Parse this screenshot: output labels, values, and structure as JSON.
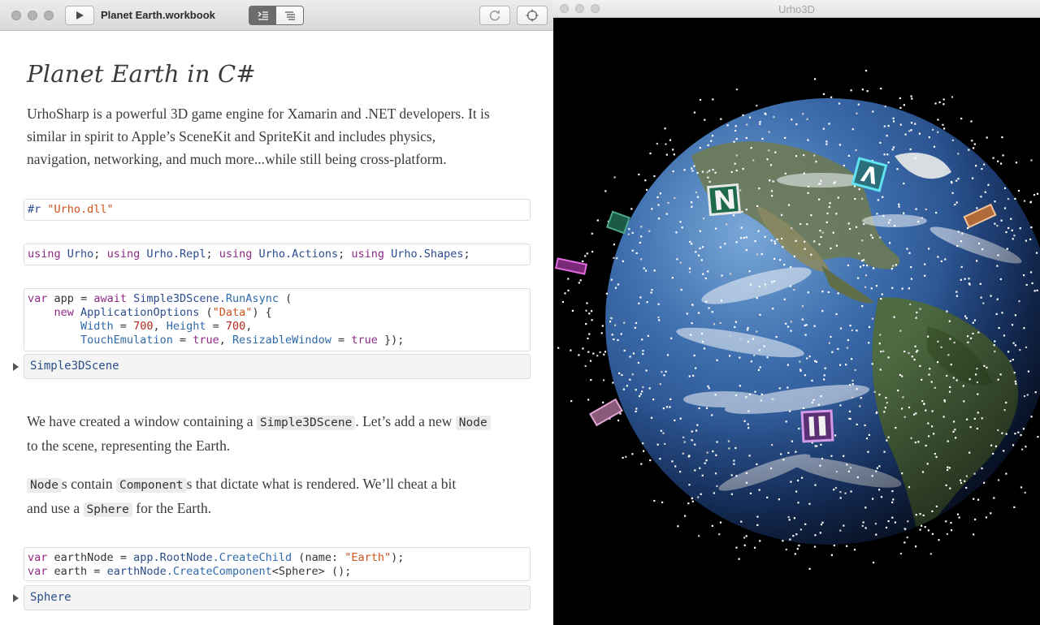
{
  "workbook": {
    "title": "Planet Earth.workbook",
    "heading": "Planet Earth in C#",
    "intro": [
      "UrhoSharp is a powerful 3D game engine for Xamarin and .NET developers. It is",
      "similar in spirit to Apple’s SceneKit and SpriteKit and includes physics,",
      "navigation, networking, and much more...while still being cross-platform."
    ],
    "cells": {
      "ref": {
        "directive": "#r",
        "file": "\"Urho.dll\""
      },
      "usings": {
        "kw": "using",
        "ns": [
          "Urho",
          "Urho.Repl",
          "Urho.Actions",
          "Urho.Shapes"
        ]
      },
      "scene": {
        "line1": {
          "var": "var",
          "name": "app",
          "eq": "=",
          "await": "await",
          "cls": "Simple3DScene",
          "method": ".RunAsync",
          "open": "("
        },
        "line2": {
          "new": "new",
          "cls": "ApplicationOptions",
          "arg": "\"Data\"",
          "rest": ") {"
        },
        "line3": {
          "w": "Width",
          "wv": "700",
          "h": "Height",
          "hv": "700"
        },
        "line4": {
          "te": "TouchEmulation",
          "tv": "true",
          "rw": "ResizableWindow",
          "rv": "true",
          "end": "});"
        },
        "result": "Simple3DScene"
      },
      "earth": {
        "line1": {
          "var": "var",
          "name": "earthNode",
          "root": "app.RootNode",
          "method": ".CreateChild",
          "param": "name:",
          "arg": "\"Earth\""
        },
        "line2": {
          "var": "var",
          "name": "earth",
          "obj": "earthNode",
          "method": ".CreateComponent",
          "generic": "<Sphere>",
          "end": "();"
        },
        "result": "Sphere"
      }
    },
    "para2": {
      "a": "We have created a window containing a",
      "code1": "Simple3DScene",
      "b": ". Let’s add a new",
      "code2": "Node",
      "c": "to the scene, representing the Earth."
    },
    "para3": {
      "code1": "Node",
      "a": "s contain",
      "code2": "Component",
      "b": "s that dictate what is rendered. We’ll cheat a bit",
      "c": "and use a",
      "code3": "Sphere",
      "d": "for the Earth."
    }
  },
  "urho": {
    "title": "Urho3D"
  },
  "icons": [
    "play-icon",
    "outline-view-icon",
    "list-view-icon",
    "refresh-icon",
    "target-icon"
  ]
}
